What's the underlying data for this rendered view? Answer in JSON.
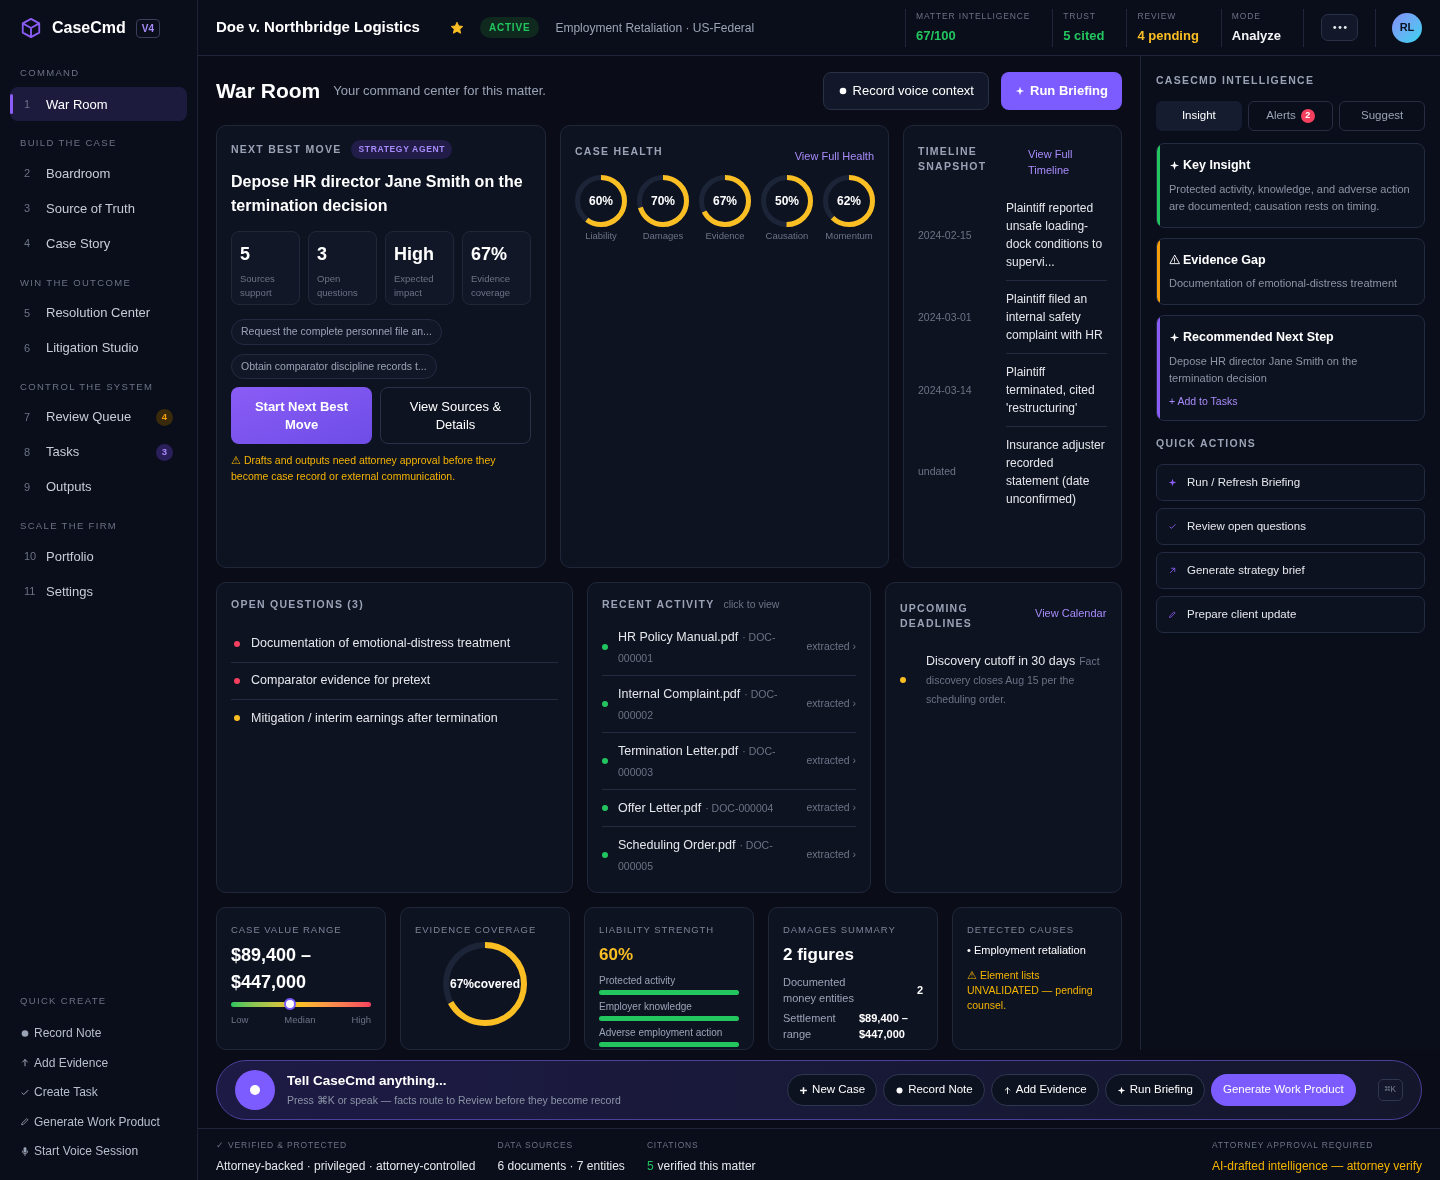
{
  "brand": {
    "name": "CaseCmd",
    "version": "V4"
  },
  "sidebar": {
    "sections": [
      {
        "title": "COMMAND",
        "items": [
          {
            "number": "1",
            "label": "War Room",
            "selected": true
          }
        ]
      },
      {
        "title": "BUILD THE CASE",
        "items": [
          {
            "number": "2",
            "label": "Boardroom",
            "selected": false
          },
          {
            "number": "3",
            "label": "Source of Truth",
            "selected": false
          },
          {
            "number": "4",
            "label": "Case Story",
            "selected": false
          }
        ]
      },
      {
        "title": "WIN THE OUTCOME",
        "items": [
          {
            "number": "5",
            "label": "Resolution Center",
            "selected": false
          },
          {
            "number": "6",
            "label": "Litigation Studio",
            "selected": false
          }
        ]
      },
      {
        "title": "CONTROL THE SYSTEM",
        "items": [
          {
            "number": "7",
            "label": "Review Queue",
            "selected": false,
            "badge": "4",
            "kind": "warning"
          },
          {
            "number": "8",
            "label": "Tasks",
            "selected": false,
            "badge": "3",
            "kind": "info"
          },
          {
            "number": "9",
            "label": "Outputs",
            "selected": false
          }
        ]
      },
      {
        "title": "SCALE THE FIRM",
        "items": [
          {
            "number": "10",
            "label": "Portfolio",
            "selected": false
          },
          {
            "number": "11",
            "label": "Settings",
            "selected": false
          }
        ]
      }
    ],
    "quick_create": {
      "title": "QUICK CREATE",
      "items": [
        {
          "kind": "note",
          "label": "Record Note"
        },
        {
          "kind": "evidence",
          "label": "Add Evidence"
        },
        {
          "kind": "task",
          "label": "Create Task"
        },
        {
          "kind": "product",
          "label": "Generate Work Product"
        },
        {
          "kind": "voice",
          "label": "Start Voice Session"
        }
      ]
    }
  },
  "top_bar": {
    "matter": "Doe v. Northbridge Logistics",
    "starred": true,
    "status": "ACTIVE",
    "practice": "Employment Retaliation · US-Federal",
    "stats": [
      {
        "label": "MATTER INTELLIGENCE",
        "value": "67/100",
        "color": "#22c55e"
      },
      {
        "label": "TRUST",
        "value": "5 cited",
        "color": "#22c55e"
      },
      {
        "label": "REVIEW",
        "value": "4 pending",
        "color": "#fbbf24"
      },
      {
        "label": "MODE",
        "value": "Analyze",
        "color": "#f3f4f6"
      }
    ],
    "avatar": "RL"
  },
  "page": {
    "title": "War Room",
    "subtitle": "Your command center for this matter.",
    "buttons": [
      {
        "label": "Record voice context",
        "kind": "secondary"
      },
      {
        "label": "Run Briefing",
        "kind": "primary"
      }
    ]
  },
  "next_best_move": {
    "title": "NEXT BEST MOVE",
    "tag": "STRATEGY AGENT",
    "headline": "Depose HR director Jane Smith on the termination decision",
    "stats": [
      {
        "value": "5",
        "label": "Sources support"
      },
      {
        "value": "3",
        "label": "Open questions"
      },
      {
        "value": "High",
        "label": "Expected impact"
      },
      {
        "value": "67%",
        "label": "Evidence coverage"
      }
    ],
    "chips": [
      "Request the complete personnel file an...",
      "Obtain comparator discipline records t..."
    ],
    "buttons": [
      {
        "label": "Start Next Best Move",
        "kind": "primary"
      },
      {
        "label": "View Sources & Details",
        "kind": "secondary"
      }
    ],
    "warning": "⚠ Drafts and outputs need attorney approval before they become case record or external communication."
  },
  "case_health": {
    "title": "CASE HEALTH",
    "link": "View Full Health",
    "metrics": [
      {
        "value": "60%",
        "label": "Liability",
        "level": 0.6
      },
      {
        "value": "70%",
        "label": "Damages",
        "level": 0.7
      },
      {
        "value": "67%",
        "label": "Evidence",
        "level": 0.67
      },
      {
        "value": "50%",
        "label": "Causation",
        "level": 0.5
      },
      {
        "value": "62%",
        "label": "Momentum",
        "level": 0.62
      }
    ]
  },
  "timeline": {
    "title": "TIMELINE SNAPSHOT",
    "link": "View Full Timeline",
    "events": [
      {
        "date": "2024-02-15",
        "text": "Plaintiff reported unsafe loading-dock conditions to supervi..."
      },
      {
        "date": "2024-03-01",
        "text": "Plaintiff filed an internal safety complaint with HR"
      },
      {
        "date": "2024-03-14",
        "text": "Plaintiff terminated, cited 'restructuring'"
      },
      {
        "date": "undated",
        "text": "Insurance adjuster recorded statement (date unconfirmed)"
      }
    ]
  },
  "open_questions": {
    "title": "OPEN QUESTIONS (3)",
    "items": [
      {
        "text": "Documentation of emotional-distress treatment",
        "color": "#f43f5e"
      },
      {
        "text": "Comparator evidence for pretext",
        "color": "#f43f5e"
      },
      {
        "text": "Mitigation / interim earnings after termination",
        "color": "#fbbf24"
      }
    ]
  },
  "recent_activity": {
    "title": "RECENT ACTIVITY",
    "hint": "click to view",
    "items": [
      {
        "file": "HR Policy Manual.pdf",
        "doc": "· DOC-000001",
        "status": "extracted ›"
      },
      {
        "file": "Internal Complaint.pdf",
        "doc": "· DOC-000002",
        "status": "extracted ›"
      },
      {
        "file": "Termination Letter.pdf",
        "doc": "· DOC-000003",
        "status": "extracted ›"
      },
      {
        "file": "Offer Letter.pdf",
        "doc": "· DOC-000004",
        "status": "extracted ›"
      },
      {
        "file": "Scheduling Order.pdf",
        "doc": "· DOC-000005",
        "status": "extracted ›"
      }
    ]
  },
  "deadlines": {
    "title": "UPCOMING DEADLINES",
    "link": "View Calendar",
    "items": [
      {
        "title": "Discovery cutoff in 30 days",
        "note": "Fact discovery closes Aug 15 per the scheduling order."
      }
    ]
  },
  "case_value": {
    "title": "CASE VALUE RANGE",
    "value": "$89,400 – $447,000",
    "level": 0.42,
    "labels": [
      "Low",
      "Median",
      "High"
    ]
  },
  "evidence_coverage": {
    "title": "EVIDENCE COVERAGE",
    "value": "67%covered",
    "level": 0.67
  },
  "liability": {
    "title": "LIABILITY STRENGTH",
    "value": "60%",
    "elements": [
      {
        "label": "Protected activity",
        "level": 1
      },
      {
        "label": "Employer knowledge",
        "level": 1
      },
      {
        "label": "Adverse employment action",
        "level": 1
      }
    ]
  },
  "damages": {
    "title": "DAMAGES SUMMARY",
    "value": "2 figures",
    "rows": [
      {
        "label": "Documented money entities",
        "value": "2"
      },
      {
        "label": "Settlement range",
        "value": "$89,400 – $447,000"
      }
    ]
  },
  "causes": {
    "title": "DETECTED CAUSES",
    "items": [
      "• Employment retaliation"
    ],
    "warning": "⚠ Element lists UNVALIDATED — pending counsel."
  },
  "intelligence": {
    "title": "CASECMD INTELLIGENCE",
    "tabs": [
      {
        "label": "Insight",
        "selected": true
      },
      {
        "label": "Alerts",
        "selected": false,
        "badge": "2"
      },
      {
        "label": "Suggest",
        "selected": false
      }
    ],
    "cards": [
      {
        "kind": "insight",
        "title": "Key Insight",
        "text": "Protected activity, knowledge, and adverse action are documented; causation rests on timing.",
        "color": "#22c55e"
      },
      {
        "kind": "gap",
        "title": "Evidence Gap",
        "text": "Documentation of emotional-distress treatment",
        "color": "#f59e0b"
      },
      {
        "kind": "next-step",
        "title": "Recommended Next Step",
        "text": "Depose HR director Jane Smith on the termination decision",
        "link": "+ Add to Tasks",
        "color": "#8b5cf6"
      }
    ]
  },
  "quick_actions": {
    "title": "QUICK ACTIONS",
    "items": [
      {
        "kind": "briefing",
        "label": "Run / Refresh Briefing"
      },
      {
        "kind": "review",
        "label": "Review open questions"
      },
      {
        "kind": "brief",
        "label": "Generate strategy brief"
      },
      {
        "kind": "update",
        "label": "Prepare client update"
      }
    ]
  },
  "command_bar": {
    "title": "Tell CaseCmd anything...",
    "hint": "Press ⌘K or speak — facts route to Review before they become record",
    "buttons": [
      {
        "kind": "new",
        "label": "New Case"
      },
      {
        "kind": "record",
        "label": "Record Note"
      },
      {
        "kind": "evidence",
        "label": "Add Evidence"
      },
      {
        "kind": "briefing",
        "label": "Run Briefing"
      },
      {
        "kind": "primary",
        "label": "Generate Work Product"
      }
    ],
    "shortcut": "⌘K"
  },
  "status_bar": [
    {
      "label": "✓ VERIFIED & PROTECTED",
      "value": "Attorney-backed · privileged · attorney-controlled"
    },
    {
      "label": "DATA SOURCES",
      "value": "6 documents · 7 entities"
    },
    {
      "label": "CITATIONS",
      "count": "5",
      "value": "verified this matter"
    },
    {
      "label": "ATTORNEY APPROVAL REQUIRED",
      "value": "AI-drafted intelligence — attorney verify",
      "kind": "warning"
    }
  ]
}
